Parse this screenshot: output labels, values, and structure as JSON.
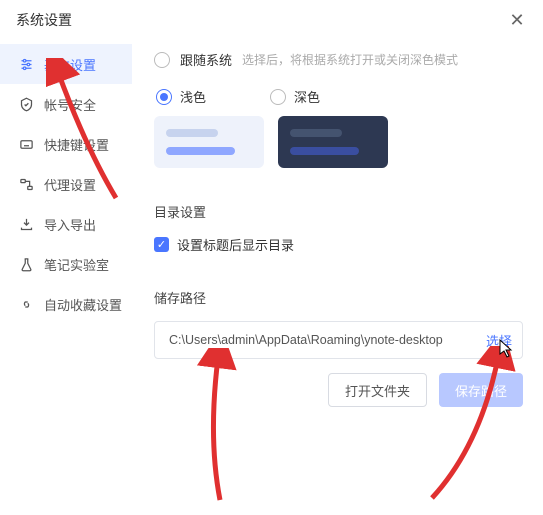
{
  "header": {
    "title": "系统设置"
  },
  "sidebar": {
    "items": [
      {
        "label": "基本设置",
        "icon": "sliders-icon"
      },
      {
        "label": "帐号安全",
        "icon": "shield-icon"
      },
      {
        "label": "快捷键设置",
        "icon": "keyboard-icon"
      },
      {
        "label": "代理设置",
        "icon": "proxy-icon"
      },
      {
        "label": "导入导出",
        "icon": "import-export-icon"
      },
      {
        "label": "笔记实验室",
        "icon": "lab-icon"
      },
      {
        "label": "自动收藏设置",
        "icon": "link-icon"
      }
    ]
  },
  "theme": {
    "follow_label": "跟随系统",
    "follow_hint": "选择后，将根据系统打开或关闭深色模式",
    "light_label": "浅色",
    "dark_label": "深色"
  },
  "directory": {
    "section_title": "目录设置",
    "checkbox_label": "设置标题后显示目录"
  },
  "storage": {
    "section_title": "储存路径",
    "path": "C:\\Users\\admin\\AppData\\Roaming\\ynote-desktop",
    "select_label": "选择",
    "open_folder_label": "打开文件夹",
    "save_path_label": "保存路径"
  }
}
